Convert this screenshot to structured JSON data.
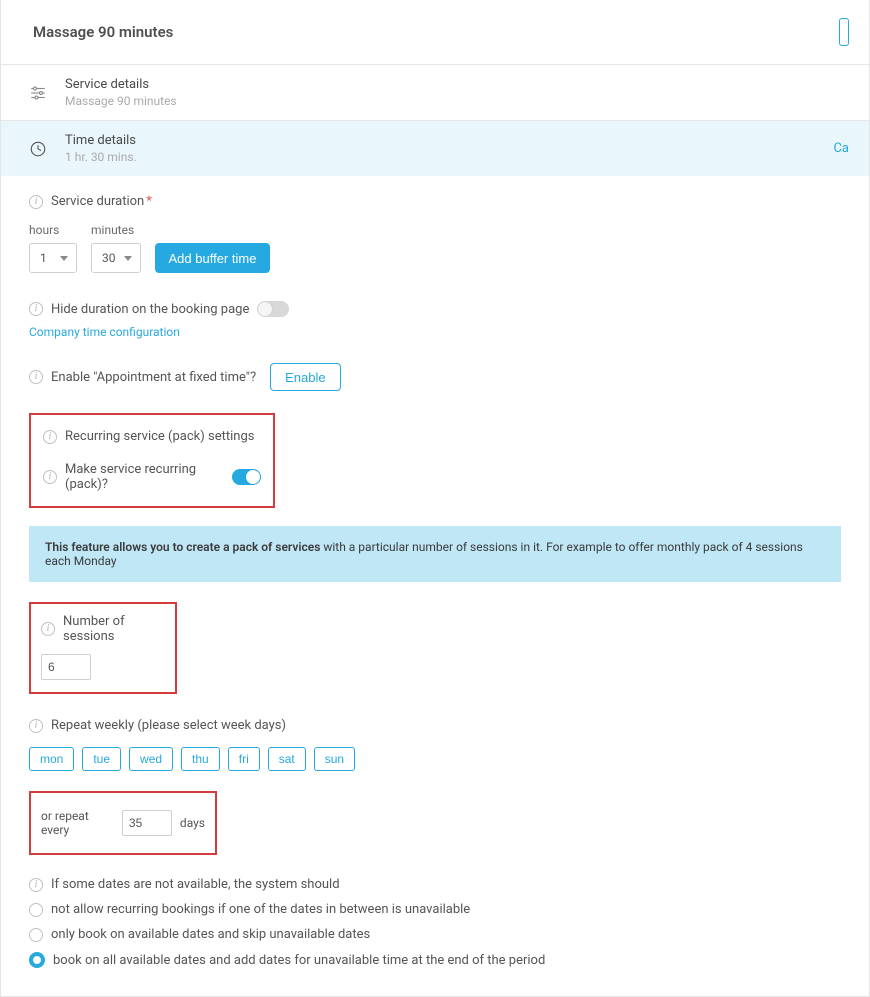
{
  "header": {
    "title": "Massage 90 minutes"
  },
  "service_details": {
    "title": "Service details",
    "subtitle": "Massage 90 minutes"
  },
  "time_details": {
    "title": "Time details",
    "subtitle": "1 hr. 30 mins.",
    "right_link": "Ca"
  },
  "duration": {
    "label": "Service duration",
    "hours_label": "hours",
    "minutes_label": "minutes",
    "hours_value": "1",
    "minutes_value": "30",
    "add_buffer": "Add buffer time"
  },
  "hide_duration": {
    "label": "Hide duration on the booking page",
    "link": "Company time configuration"
  },
  "fixed_time": {
    "label": "Enable \"Appointment at fixed time\"?",
    "button": "Enable"
  },
  "recurring": {
    "settings_label": "Recurring service (pack) settings",
    "toggle_label": "Make service recurring (pack)?"
  },
  "banner": {
    "bold": "This feature allows you to create a pack of services",
    "rest": " with a particular number of sessions in it. For example to offer monthly pack of 4 sessions each Monday"
  },
  "sessions": {
    "label": "Number of sessions",
    "value": "6"
  },
  "repeat_weekly": {
    "label": "Repeat weekly (please select week days)",
    "days": {
      "mon": "mon",
      "tue": "tue",
      "wed": "wed",
      "thu": "thu",
      "fri": "fri",
      "sat": "sat",
      "sun": "sun"
    }
  },
  "repeat_every": {
    "prefix": "or repeat every",
    "value": "35",
    "suffix": "days"
  },
  "unavailable": {
    "heading": "If some dates are not available, the system should",
    "opt1": "not allow recurring bookings if one of the dates in between is unavailable",
    "opt2": "only book on available dates and skip unavailable dates",
    "opt3": "book on all available dates and add dates for unavailable time at the end of the period"
  }
}
